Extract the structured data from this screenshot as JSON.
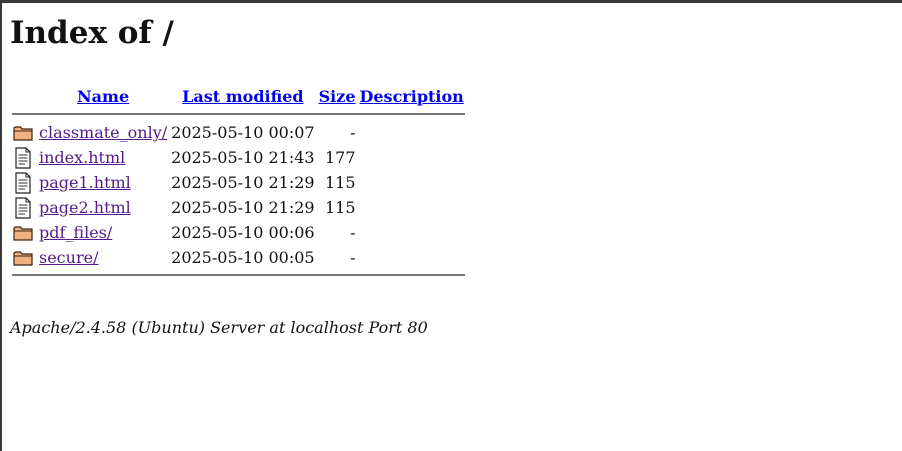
{
  "page": {
    "title": "Index of /"
  },
  "table": {
    "headers": {
      "name": "Name",
      "last_modified": "Last modified",
      "size": "Size",
      "description": "Description"
    },
    "rows": [
      {
        "icon": "folder-icon",
        "name": "classmate_only/",
        "modified": "2025-05-10 00:07",
        "size": "-",
        "description": ""
      },
      {
        "icon": "text-file-icon",
        "name": "index.html",
        "modified": "2025-05-10 21:43",
        "size": "177",
        "description": ""
      },
      {
        "icon": "text-file-icon",
        "name": "page1.html",
        "modified": "2025-05-10 21:29",
        "size": "115",
        "description": ""
      },
      {
        "icon": "text-file-icon",
        "name": "page2.html",
        "modified": "2025-05-10 21:29",
        "size": "115",
        "description": ""
      },
      {
        "icon": "folder-icon",
        "name": "pdf_files/",
        "modified": "2025-05-10 00:06",
        "size": "-",
        "description": ""
      },
      {
        "icon": "folder-icon",
        "name": "secure/",
        "modified": "2025-05-10 00:05",
        "size": "-",
        "description": ""
      }
    ]
  },
  "footer": {
    "server_signature": "Apache/2.4.58 (Ubuntu) Server at localhost Port 80"
  },
  "colors": {
    "link": "#0000ee",
    "visited_link": "#551a8b",
    "folder_fill": "#f0b080",
    "rule": "#777777"
  }
}
